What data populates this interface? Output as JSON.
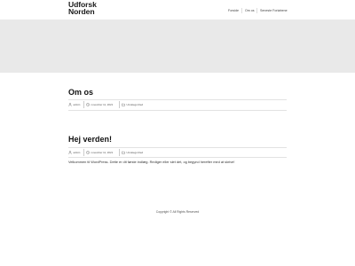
{
  "site": {
    "title": "Udforsk Norden"
  },
  "nav": {
    "items": [
      {
        "label": "Forside"
      },
      {
        "label": "Om os"
      },
      {
        "label": "Seneste Forløbene"
      }
    ]
  },
  "posts": [
    {
      "title": "Om os",
      "author": "admin",
      "date": "november 11, 2021",
      "category": "Uncategorized"
    },
    {
      "title": "Hej verden!",
      "author": "admin",
      "date": "november 11, 2021",
      "category": "Uncategorized",
      "excerpt": "Velkommen til WordPress. Dette er dit første indlæg. Rediger eller slet det, og begynd herefter med at skrive!"
    }
  ],
  "footer": {
    "text": "Copyright © All Rights Reserved"
  },
  "colors": {
    "hero": "#e9e9e9",
    "background": "#ffffff"
  },
  "icons": {
    "author": "user-icon",
    "date": "clock-icon",
    "category": "folder-icon"
  }
}
